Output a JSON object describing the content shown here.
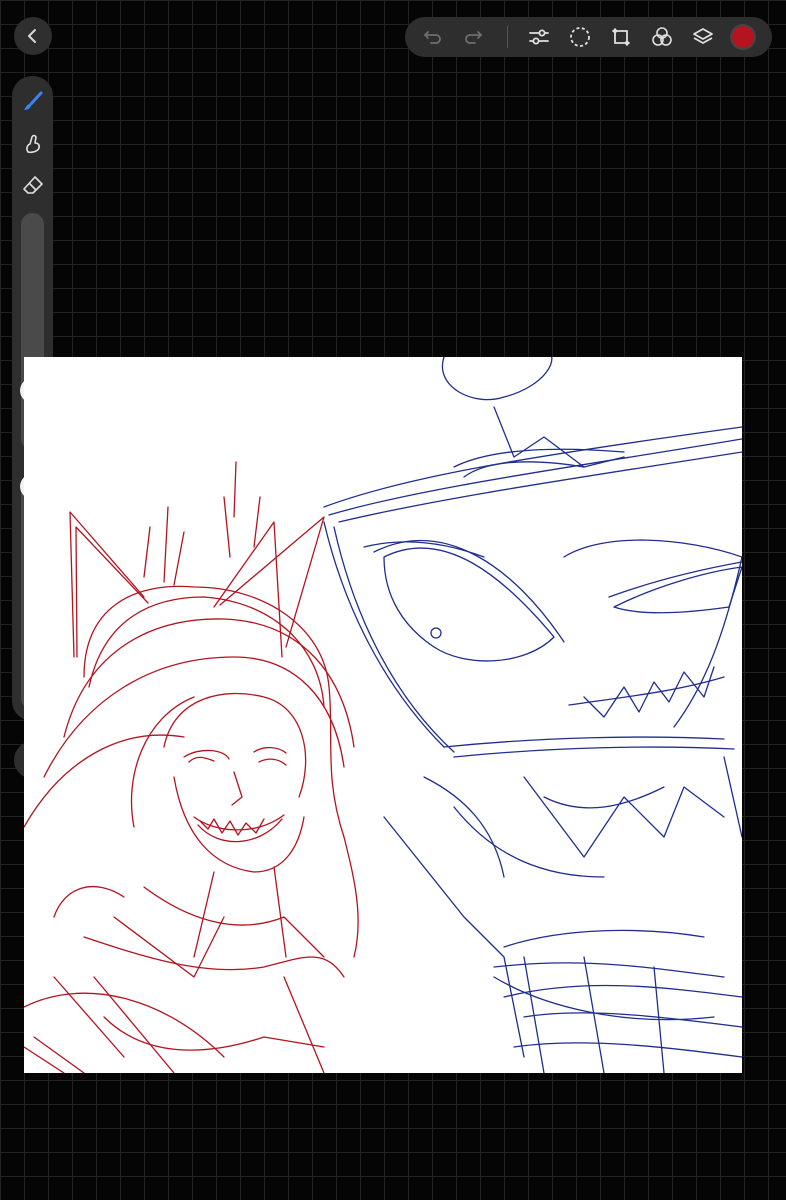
{
  "toolbar": {
    "icons": [
      "back-chevron-icon",
      "undo-icon",
      "redo-icon",
      "adjustments-icon",
      "selection-icon",
      "transform-icon",
      "color-blend-icon",
      "layers-icon"
    ],
    "active_color": "#b3141f"
  },
  "sidebar": {
    "tools": [
      "brush-icon",
      "smudge-icon",
      "eraser-icon"
    ],
    "brush_size": 0.22,
    "opacity": 1.0
  },
  "canvas": {
    "background": "#ffffff",
    "stroke_colors": {
      "left_sketch": "#b3141f",
      "right_sketch": "#1f2e8f"
    }
  }
}
